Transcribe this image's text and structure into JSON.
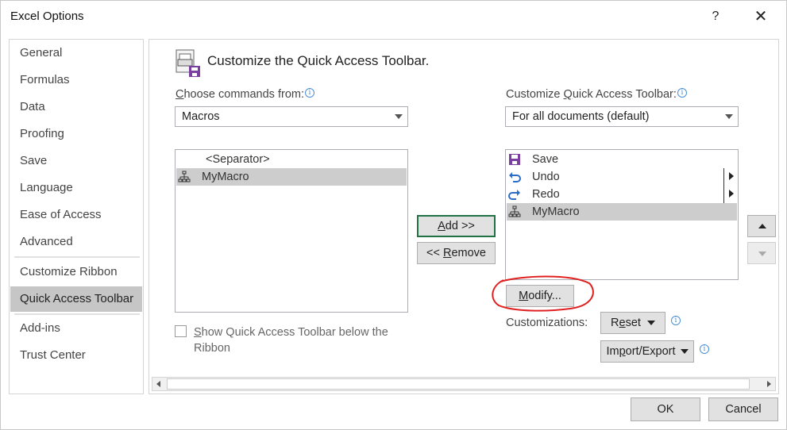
{
  "window": {
    "title": "Excel Options",
    "help_label": "?",
    "close_label": "✕"
  },
  "nav": {
    "items": [
      {
        "label": "General"
      },
      {
        "label": "Formulas"
      },
      {
        "label": "Data"
      },
      {
        "label": "Proofing"
      },
      {
        "label": "Save"
      },
      {
        "label": "Language"
      },
      {
        "label": "Ease of Access"
      },
      {
        "label": "Advanced"
      },
      {
        "label": "Customize Ribbon"
      },
      {
        "label": "Quick Access Toolbar"
      },
      {
        "label": "Add-ins"
      },
      {
        "label": "Trust Center"
      }
    ],
    "selected": "Quick Access Toolbar"
  },
  "main": {
    "heading": "Customize the Quick Access Toolbar.",
    "choose_label": {
      "accel": "C",
      "rest": "hoose commands from:"
    },
    "choose_value": "Macros",
    "customize_label": {
      "pre": "Customize ",
      "accel": "Q",
      "rest": "uick Access Toolbar:"
    },
    "customize_value": "For all documents (default)",
    "left_list": [
      {
        "label": "<Separator>",
        "icon": ""
      },
      {
        "label": "MyMacro",
        "icon": "macro-icon"
      }
    ],
    "right_list": [
      {
        "label": "Save",
        "icon": "save-icon"
      },
      {
        "label": "Undo",
        "icon": "undo-icon"
      },
      {
        "label": "Redo",
        "icon": "redo-icon"
      },
      {
        "label": "MyMacro",
        "icon": "macro-icon"
      }
    ],
    "add_button": {
      "accel": "A",
      "rest": "dd >>"
    },
    "remove_button": {
      "pre": "<< ",
      "accel": "R",
      "rest": "emove"
    },
    "modify_button": {
      "accel": "M",
      "rest": "odify..."
    },
    "customizations_label": "Customizations:",
    "reset_button": {
      "accel": "e",
      "pre": "R",
      "rest": "set"
    },
    "import_export_button": {
      "pre": "Im",
      "accel": "p",
      "rest": "ort/Export"
    },
    "show_below": {
      "accel": "S",
      "rest": "how Quick Access Toolbar below the Ribbon",
      "checked": false
    },
    "info_glyph": "i"
  },
  "footer": {
    "ok_label": "OK",
    "cancel_label": "Cancel"
  },
  "colors": {
    "accent": "#217346",
    "annotation": "#e02020",
    "selection": "#cdcdcd"
  }
}
